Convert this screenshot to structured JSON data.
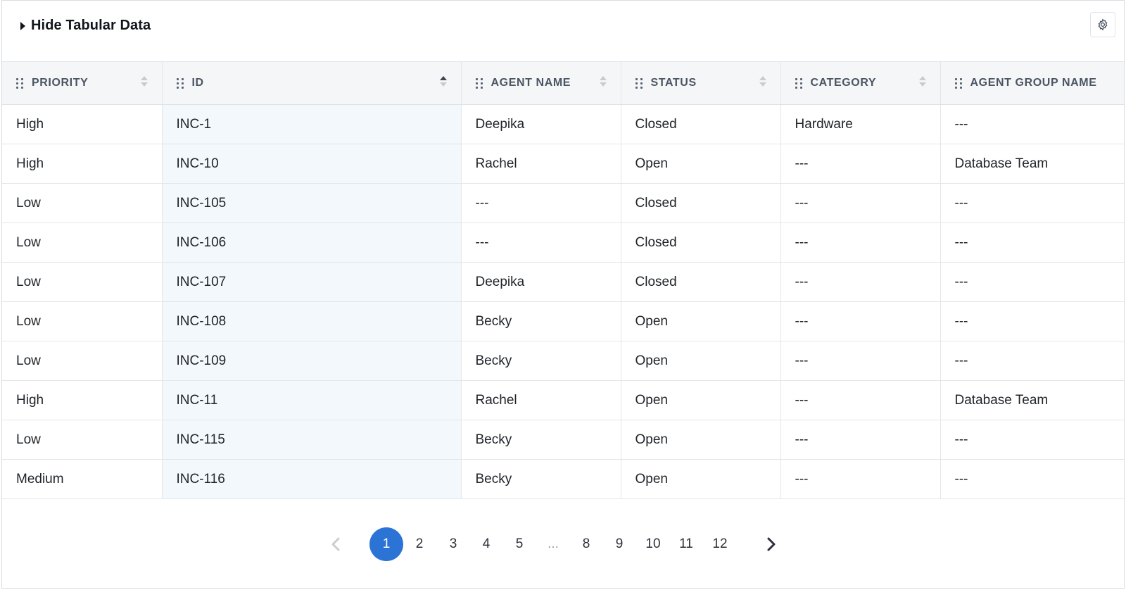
{
  "header": {
    "toggle_label": "Hide Tabular Data"
  },
  "icons": {
    "caret": "caret-right-icon",
    "settings": "gear-icon",
    "drag": "drag-handle-icon",
    "sort": "sort-icon",
    "prev": "chevron-left-icon",
    "next": "chevron-right-icon"
  },
  "colors": {
    "accent": "#2b74d6",
    "sorted_column_bg": "#f3f8fd",
    "header_bg": "#f4f6f8"
  },
  "table": {
    "columns": [
      {
        "label": "PRIORITY",
        "sorted": false
      },
      {
        "label": "ID",
        "sorted": true
      },
      {
        "label": "AGENT NAME",
        "sorted": false
      },
      {
        "label": "STATUS",
        "sorted": false
      },
      {
        "label": "CATEGORY",
        "sorted": false
      },
      {
        "label": "AGENT GROUP NAME",
        "sorted": false
      }
    ],
    "rows": [
      [
        "High",
        "INC-1",
        "Deepika",
        "Closed",
        "Hardware",
        "---"
      ],
      [
        "High",
        "INC-10",
        "Rachel",
        "Open",
        "---",
        "Database Team"
      ],
      [
        "Low",
        "INC-105",
        "---",
        "Closed",
        "---",
        "---"
      ],
      [
        "Low",
        "INC-106",
        "---",
        "Closed",
        "---",
        "---"
      ],
      [
        "Low",
        "INC-107",
        "Deepika",
        "Closed",
        "---",
        "---"
      ],
      [
        "Low",
        "INC-108",
        "Becky",
        "Open",
        "---",
        "---"
      ],
      [
        "Low",
        "INC-109",
        "Becky",
        "Open",
        "---",
        "---"
      ],
      [
        "High",
        "INC-11",
        "Rachel",
        "Open",
        "---",
        "Database Team"
      ],
      [
        "Low",
        "INC-115",
        "Becky",
        "Open",
        "---",
        "---"
      ],
      [
        "Medium",
        "INC-116",
        "Becky",
        "Open",
        "---",
        "---"
      ]
    ]
  },
  "pagination": {
    "current": "1",
    "pages": [
      "1",
      "2",
      "3",
      "4",
      "5",
      "...",
      "8",
      "9",
      "10",
      "11",
      "12"
    ]
  }
}
